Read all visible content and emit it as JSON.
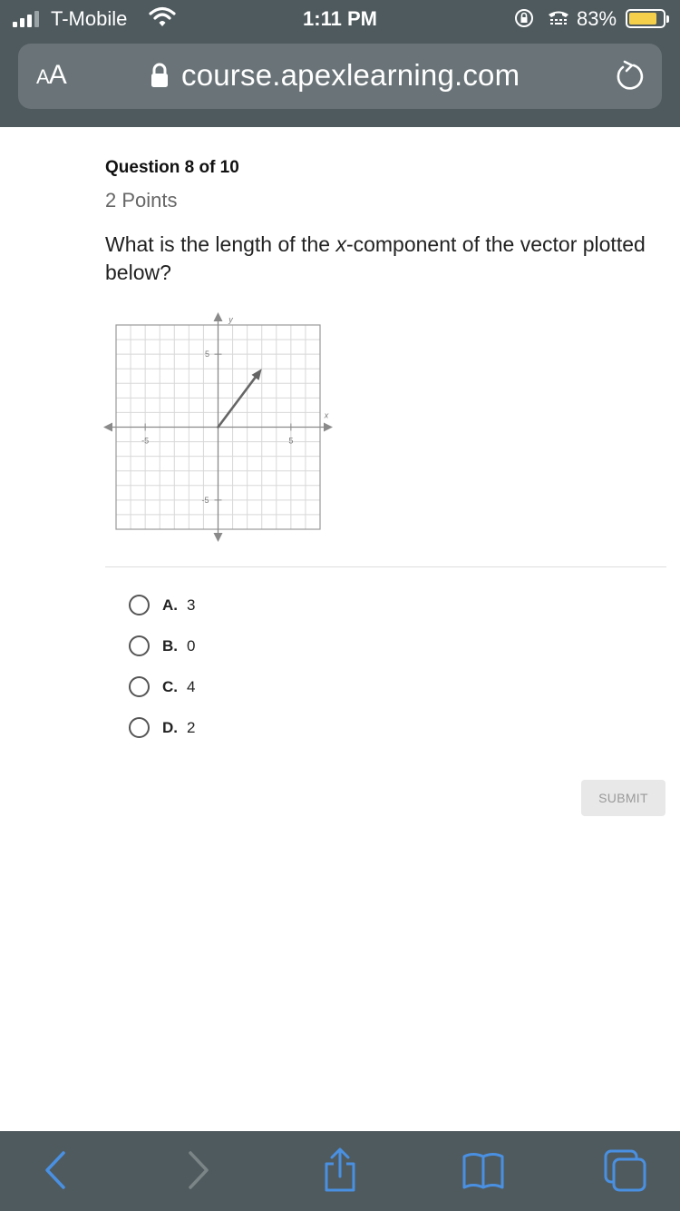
{
  "status_bar": {
    "carrier": "T-Mobile",
    "time": "1:11 PM",
    "battery_percent": "83%"
  },
  "browser": {
    "text_size_label_small": "A",
    "text_size_label_large": "A",
    "url": "course.apexlearning.com"
  },
  "question": {
    "header": "Question 8 of 10",
    "points": "2 Points",
    "prompt_before": "What is the length of the ",
    "prompt_var": "x",
    "prompt_after": "-component of the vector plotted below?"
  },
  "plot": {
    "x_axis_label": "x",
    "y_axis_label": "y",
    "x_range": [
      -7,
      7
    ],
    "y_range": [
      -7,
      7
    ],
    "tick_labels": {
      "x_neg": "-5",
      "x_pos": "5",
      "y_pos": "5",
      "y_neg": "-5"
    },
    "vector": {
      "from": [
        0,
        0
      ],
      "to": [
        3,
        4
      ]
    },
    "colors": {
      "grid": "#d8d8d8",
      "axis": "#8a8a8a",
      "border": "#9a9a9a",
      "vector": "#666666"
    }
  },
  "choices": [
    {
      "letter": "A.",
      "value": "3"
    },
    {
      "letter": "B.",
      "value": "0"
    },
    {
      "letter": "C.",
      "value": "4"
    },
    {
      "letter": "D.",
      "value": "2"
    }
  ],
  "submit_label": "SUBMIT",
  "colors": {
    "chrome_bg": "#4f5a5e",
    "toolbar_active_icon": "#4a90e2",
    "toolbar_disabled_icon": "#7b8588"
  }
}
